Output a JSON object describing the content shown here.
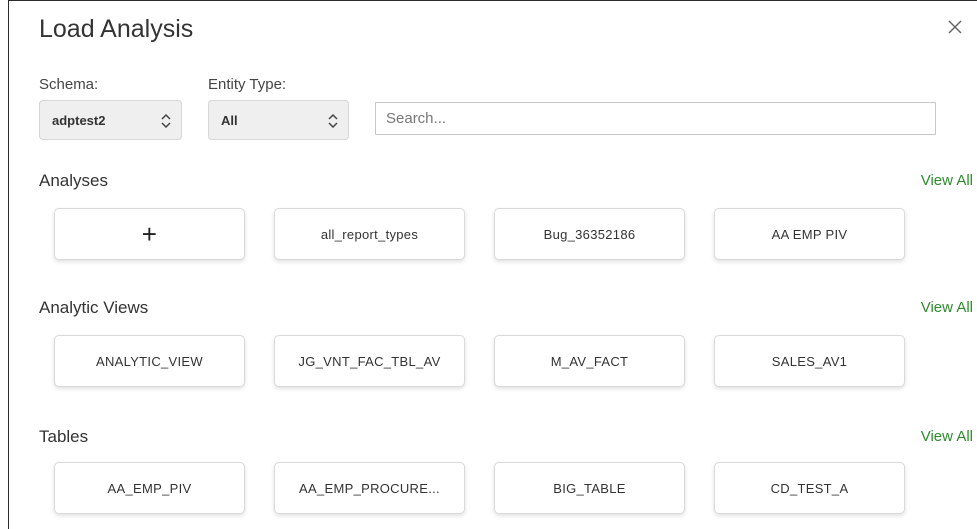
{
  "dialog": {
    "title": "Load Analysis",
    "close_icon": "close-icon"
  },
  "filters": {
    "schema_label": "Schema:",
    "schema_value": "adptest2",
    "entity_type_label": "Entity Type:",
    "entity_type_value": "All",
    "search_placeholder": "Search..."
  },
  "sections": {
    "analyses": {
      "title": "Analyses",
      "view_all": "View All",
      "add_label": "+",
      "items": [
        "all_report_types",
        "Bug_36352186",
        "AA EMP PIV"
      ]
    },
    "analytic_views": {
      "title": "Analytic Views",
      "view_all": "View All",
      "items": [
        "ANALYTIC_VIEW",
        "JG_VNT_FAC_TBL_AV",
        "M_AV_FACT",
        "SALES_AV1"
      ]
    },
    "tables": {
      "title": "Tables",
      "view_all": "View All",
      "items": [
        "AA_EMP_PIV",
        "AA_EMP_PROCURE...",
        "BIG_TABLE",
        "CD_TEST_A"
      ]
    }
  },
  "colors": {
    "accent_link": "#2e8b2e",
    "select_bg": "#efefef"
  }
}
